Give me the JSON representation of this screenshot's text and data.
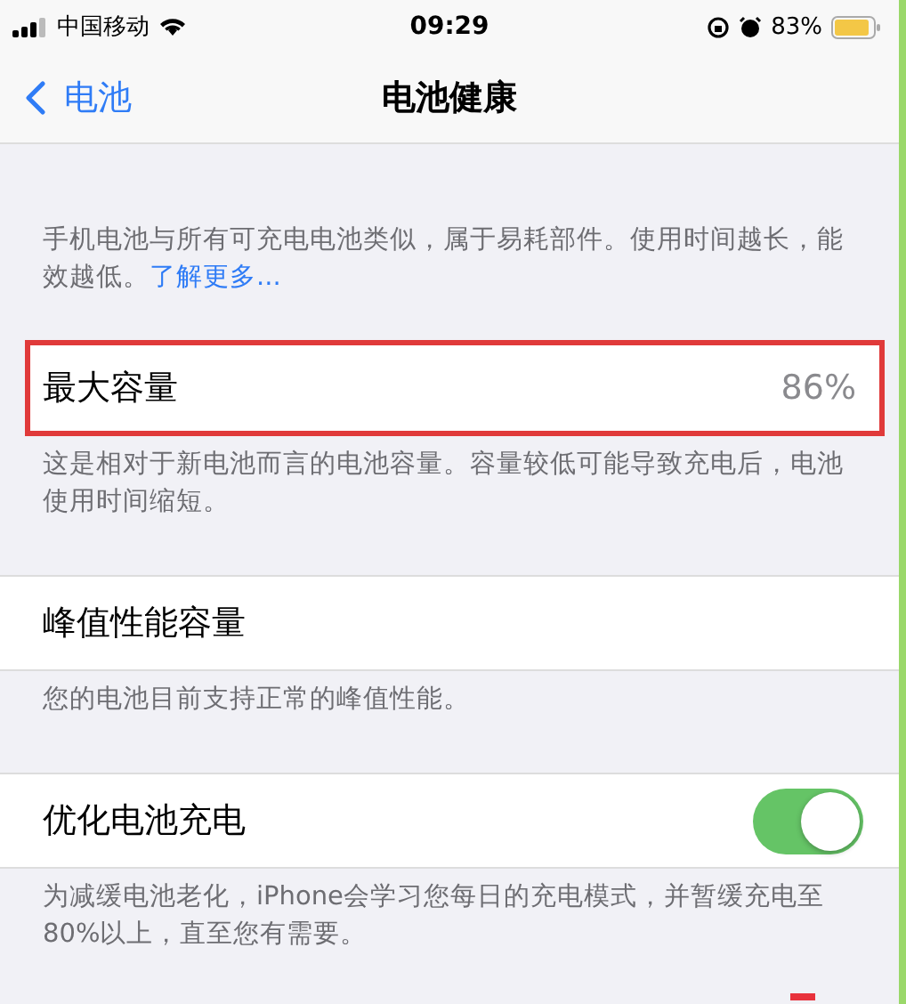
{
  "status_bar": {
    "carrier": "中国移动",
    "time": "09:29",
    "battery_percent": "83%"
  },
  "nav": {
    "back": "电池",
    "title": "电池健康"
  },
  "intro": {
    "text": "手机电池与所有可充电电池类似，属于易耗部件。使用时间越长，能效越低。",
    "link": "了解更多..."
  },
  "sections": [
    {
      "kind": "value",
      "label": "最大容量",
      "value": "86%",
      "highlighted": true,
      "footer": "这是相对于新电池而言的电池容量。容量较低可能导致充电后，电池使用时间缩短。"
    },
    {
      "kind": "plain",
      "label": "峰值性能容量",
      "highlighted": false,
      "footer": "您的电池目前支持正常的峰值性能。"
    },
    {
      "kind": "toggle",
      "label": "优化电池充电",
      "on": true,
      "highlighted": false,
      "footer": "为减缓电池老化，iPhone会学习您每日的充电模式，并暂缓充电至80%以上，直至您有需要。"
    }
  ]
}
